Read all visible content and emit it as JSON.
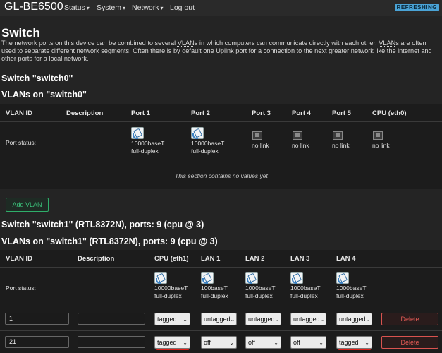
{
  "header": {
    "brand": "GL-BE6500",
    "menu": [
      "Status",
      "System",
      "Network",
      "Log out"
    ],
    "badge": "REFRESHING"
  },
  "page": {
    "title": "Switch",
    "description_parts": [
      "The network ports on this device can be combined to several ",
      "VLAN",
      "s in which computers can communicate directly with each other. ",
      "VLAN",
      "s are often used to separate different network segments. Often there is by default one Uplink port for a connection to the next greater network like the internet and other ports for a local network."
    ]
  },
  "switch0": {
    "heading": "Switch \"switch0\"",
    "vlans_heading": "VLANs on \"switch0\"",
    "columns": [
      "VLAN ID",
      "Description",
      "Port 1",
      "Port 2",
      "Port 3",
      "Port 4",
      "Port 5",
      "CPU (eth0)"
    ],
    "port_status_label": "Port status:",
    "ports": [
      {
        "icon": "ethernet-connected-icon",
        "line1": "10000baseT",
        "line2": "full-duplex"
      },
      {
        "icon": "ethernet-connected-icon",
        "line1": "10000baseT",
        "line2": "full-duplex"
      },
      {
        "icon": "ethernet-port-icon",
        "line1": "no link",
        "line2": ""
      },
      {
        "icon": "ethernet-port-icon",
        "line1": "no link",
        "line2": ""
      },
      {
        "icon": "ethernet-port-icon",
        "line1": "no link",
        "line2": ""
      },
      {
        "icon": "ethernet-port-icon",
        "line1": "no link",
        "line2": ""
      }
    ],
    "empty_note": "This section contains no values yet",
    "add_button": "Add VLAN"
  },
  "switch1": {
    "heading": "Switch \"switch1\" (RTL8372N), ports: 9 (cpu @ 3)",
    "vlans_heading": "VLANs on \"switch1\" (RTL8372N), ports: 9 (cpu @ 3)",
    "columns": [
      "VLAN ID",
      "Description",
      "CPU (eth1)",
      "LAN 1",
      "LAN 2",
      "LAN 3",
      "LAN 4"
    ],
    "port_status_label": "Port status:",
    "ports": [
      {
        "icon": "ethernet-connected-icon",
        "line1": "10000baseT",
        "line2": "full-duplex"
      },
      {
        "icon": "ethernet-connected-icon",
        "line1": "100baseT",
        "line2": "full-duplex"
      },
      {
        "icon": "ethernet-connected-icon",
        "line1": "1000baseT",
        "line2": "full-duplex"
      },
      {
        "icon": "ethernet-connected-icon",
        "line1": "1000baseT",
        "line2": "full-duplex"
      },
      {
        "icon": "ethernet-connected-icon",
        "line1": "1000baseT",
        "line2": "full-duplex"
      }
    ],
    "rows": [
      {
        "vlan_id": "1",
        "description": "",
        "cpu": "tagged",
        "lan1": "untagged",
        "lan2": "untagged",
        "lan3": "untagged",
        "lan4": "untagged",
        "delete": "Delete"
      },
      {
        "vlan_id": "21",
        "description": "",
        "cpu": "tagged",
        "lan1": "off",
        "lan2": "off",
        "lan3": "off",
        "lan4": "tagged",
        "delete": "Delete"
      }
    ]
  },
  "colors": {
    "background": "#242424",
    "add_button": "#3cc47c",
    "delete_button": "#e35a55",
    "badge": "#4aa3d6",
    "annotation_underline": "#e0201a"
  }
}
